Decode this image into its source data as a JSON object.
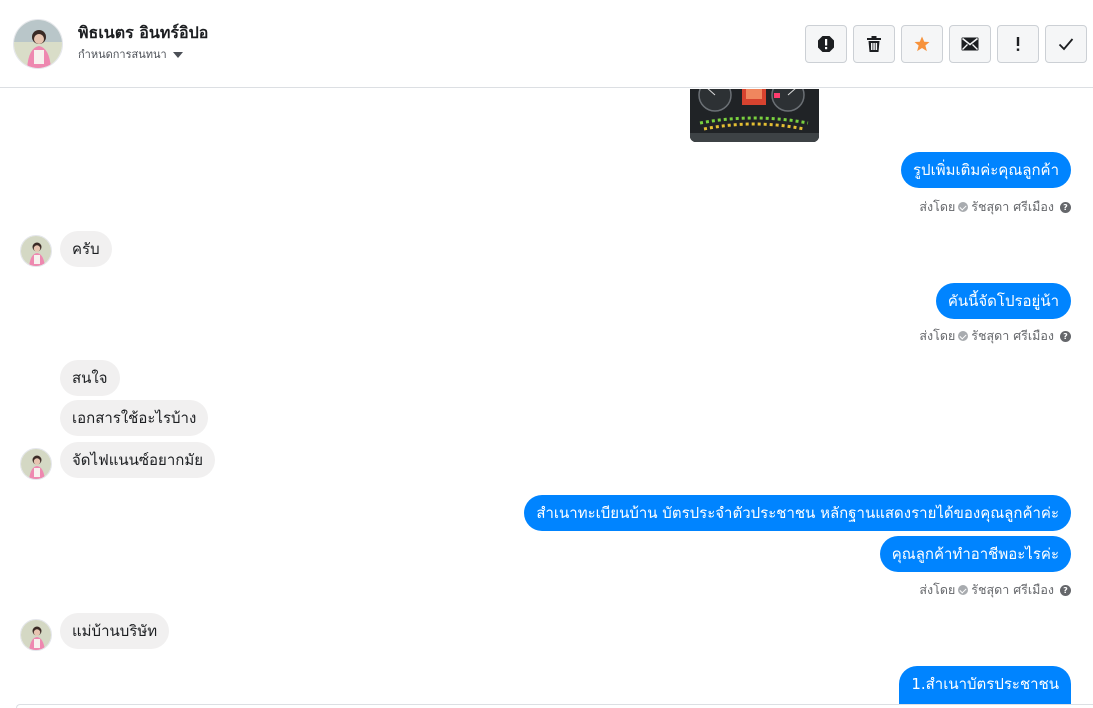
{
  "header": {
    "name": "พิธเนตร อินทร์อิปอ",
    "subtitle": "กำหนดการสนทนา",
    "toolbar": [
      {
        "name": "report-icon",
        "label": "report"
      },
      {
        "name": "trash-icon",
        "label": "delete"
      },
      {
        "name": "star-icon",
        "label": "star"
      },
      {
        "name": "mail-icon",
        "label": "mark-unread"
      },
      {
        "name": "exclamation-icon",
        "label": "important"
      },
      {
        "name": "check-icon",
        "label": "done"
      }
    ],
    "star_color": "#f7923b"
  },
  "colors": {
    "outgoing_bubble": "#0084ff",
    "incoming_bubble": "#f1f0f0"
  },
  "messages": [
    {
      "dir": "out",
      "text": "รูปเพิ่มเติมค่ะคุณลูกค้า"
    },
    {
      "dir": "meta",
      "prefix": "ส่งโดย",
      "sender": "รัชสุดา ศรีเมือง"
    },
    {
      "dir": "in",
      "text": "ครับ"
    },
    {
      "dir": "out",
      "text": "คันนี้จัดโปรอยู่น้า"
    },
    {
      "dir": "meta",
      "prefix": "ส่งโดย",
      "sender": "รัชสุดา ศรีเมือง"
    },
    {
      "dir": "in",
      "text": "สนใจ"
    },
    {
      "dir": "in",
      "text": "เอกสารใช้อะไรบ้าง"
    },
    {
      "dir": "in",
      "text": "จัดไฟแนนซ์อยากมัย"
    },
    {
      "dir": "out",
      "text": "สำเนาทะเบียนบ้าน บัตรประจำตัวประชาชน หลักฐานแสดงรายได้ของคุณลูกค้าค่ะ"
    },
    {
      "dir": "out",
      "text": "คุณลูกค้าทำอาชีพอะไรค่ะ"
    },
    {
      "dir": "meta",
      "prefix": "ส่งโดย",
      "sender": "รัชสุดา ศรีเมือง"
    },
    {
      "dir": "in",
      "text": "แม่บ้านบริษัท"
    },
    {
      "dir": "out",
      "text": "1.สำเนาบัตรประชาชน"
    }
  ]
}
